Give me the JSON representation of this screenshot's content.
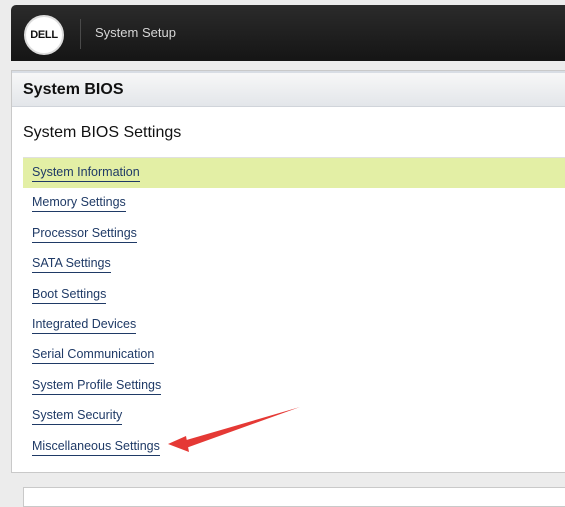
{
  "header": {
    "logo_text": "DELL",
    "app_title": "System Setup"
  },
  "panel": {
    "title": "System BIOS",
    "section_title": "System BIOS Settings",
    "items": [
      {
        "label": "System Information",
        "selected": true
      },
      {
        "label": "Memory Settings"
      },
      {
        "label": "Processor Settings"
      },
      {
        "label": "SATA Settings"
      },
      {
        "label": "Boot Settings"
      },
      {
        "label": "Integrated Devices"
      },
      {
        "label": "Serial Communication"
      },
      {
        "label": "System Profile Settings"
      },
      {
        "label": "System Security"
      },
      {
        "label": "Miscellaneous Settings"
      }
    ]
  },
  "annotation": {
    "icon": "red-arrow-icon",
    "color": "#e53935"
  },
  "colors": {
    "selected_row": "#e3efa5",
    "link": "#1f3a66",
    "topbar": "#1e1e1e"
  }
}
